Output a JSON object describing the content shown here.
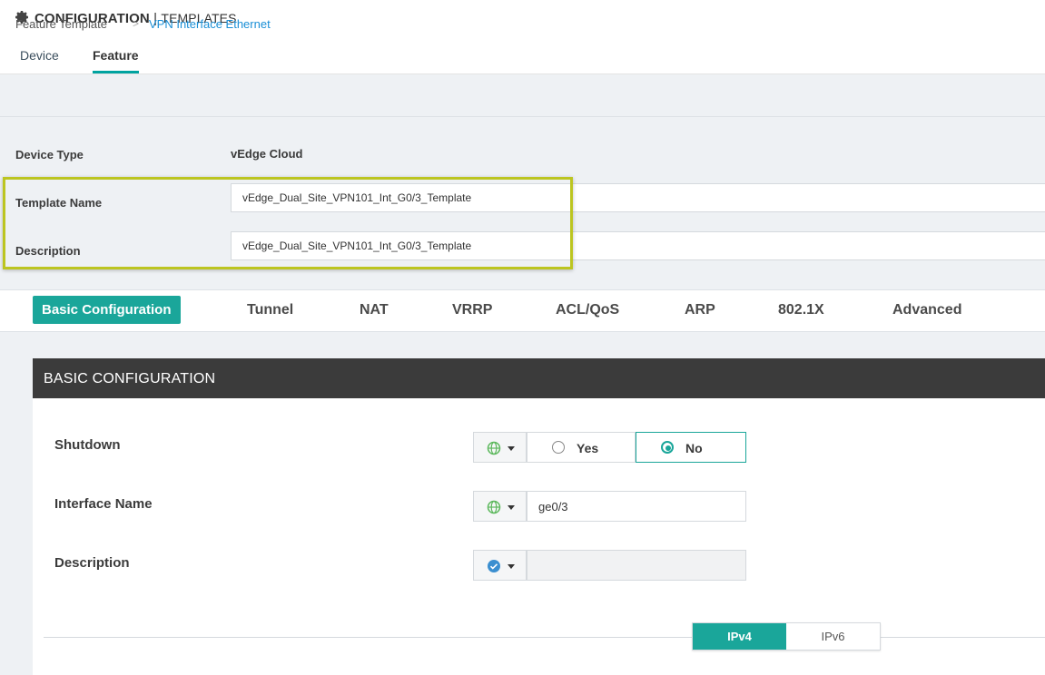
{
  "header": {
    "title": "CONFIGURATION",
    "separator": "|",
    "subtitle": "TEMPLATES"
  },
  "tabs": [
    {
      "label": "Device",
      "active": false
    },
    {
      "label": "Feature",
      "active": true
    }
  ],
  "breadcrumb": {
    "root": "Feature Template",
    "separator": ">",
    "current": "VPN Interface Ethernet"
  },
  "form": {
    "device_type_label": "Device Type",
    "device_type_value": "vEdge Cloud",
    "template_name_label": "Template Name",
    "template_name_value": "vEdge_Dual_Site_VPN101_Int_G0/3_Template",
    "description_label": "Description",
    "description_value": "vEdge_Dual_Site_VPN101_Int_G0/3_Template"
  },
  "section_tabs": [
    {
      "label": "Basic Configuration",
      "active": true
    },
    {
      "label": "Tunnel",
      "active": false
    },
    {
      "label": "NAT",
      "active": false
    },
    {
      "label": "VRRP",
      "active": false
    },
    {
      "label": "ACL/QoS",
      "active": false
    },
    {
      "label": "ARP",
      "active": false
    },
    {
      "label": "802.1X",
      "active": false
    },
    {
      "label": "Advanced",
      "active": false
    }
  ],
  "basic_config": {
    "title": "BASIC CONFIGURATION",
    "shutdown": {
      "label": "Shutdown",
      "scope_icon": "globe-icon",
      "options": [
        "Yes",
        "No"
      ],
      "selected": "No"
    },
    "interface_name": {
      "label": "Interface Name",
      "scope_icon": "globe-icon",
      "value": "ge0/3"
    },
    "description": {
      "label": "Description",
      "scope_icon": "check-circle-icon",
      "value": ""
    },
    "ip_toggle": {
      "options": [
        "IPv4",
        "IPv6"
      ],
      "selected": "IPv4"
    }
  },
  "colors": {
    "accent": "#1aa69a",
    "link": "#1a8fd6",
    "highlight": "#bcc520",
    "panel_header": "#3b3b3b",
    "globe": "#5cb85c",
    "check": "#3b8fd0"
  }
}
